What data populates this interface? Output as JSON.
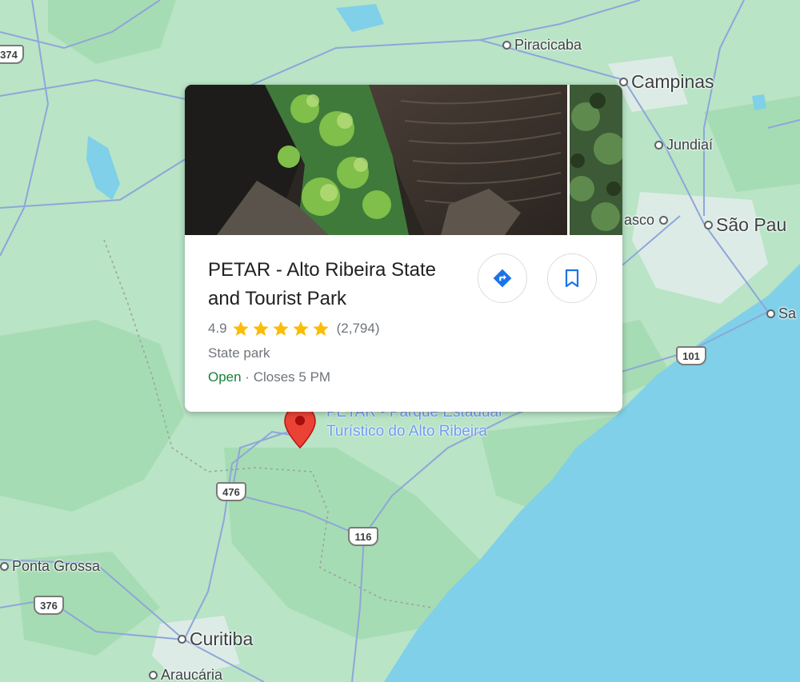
{
  "map": {
    "cities": {
      "piracicaba": "Piracicaba",
      "campinas": "Campinas",
      "jundiai": "Jundiaí",
      "osasco": "asco",
      "sao_paulo": "São Pau",
      "santos": "Sa",
      "ponta_grossa": "Ponta Grossa",
      "curitiba": "Curitiba",
      "araucaria": "Araucária"
    },
    "routes": {
      "r374": "374",
      "r101": "101",
      "r476": "476",
      "r116": "116",
      "r376": "376"
    },
    "place_label_line1": "PETAR - Parque Estadual",
    "place_label_line2": "Turístico do Alto Ribeira",
    "colors": {
      "land": "#b9e4c6",
      "forest": "#a6dcb3",
      "water": "#7fd0e8",
      "road": "#8ea6d9",
      "pin": "#ea4335"
    }
  },
  "place_card": {
    "title": "PETAR - Alto Ribeira State and Tourist Park",
    "rating": "4.9",
    "stars": 5,
    "review_count": "(2,794)",
    "category": "State park",
    "status": "Open",
    "hours_detail": " · Closes 5 PM",
    "actions": {
      "directions": "directions-icon",
      "save": "bookmark-icon"
    },
    "colors": {
      "star": "#fbbc04",
      "open": "#188038",
      "action_icon": "#1a73e8"
    }
  }
}
